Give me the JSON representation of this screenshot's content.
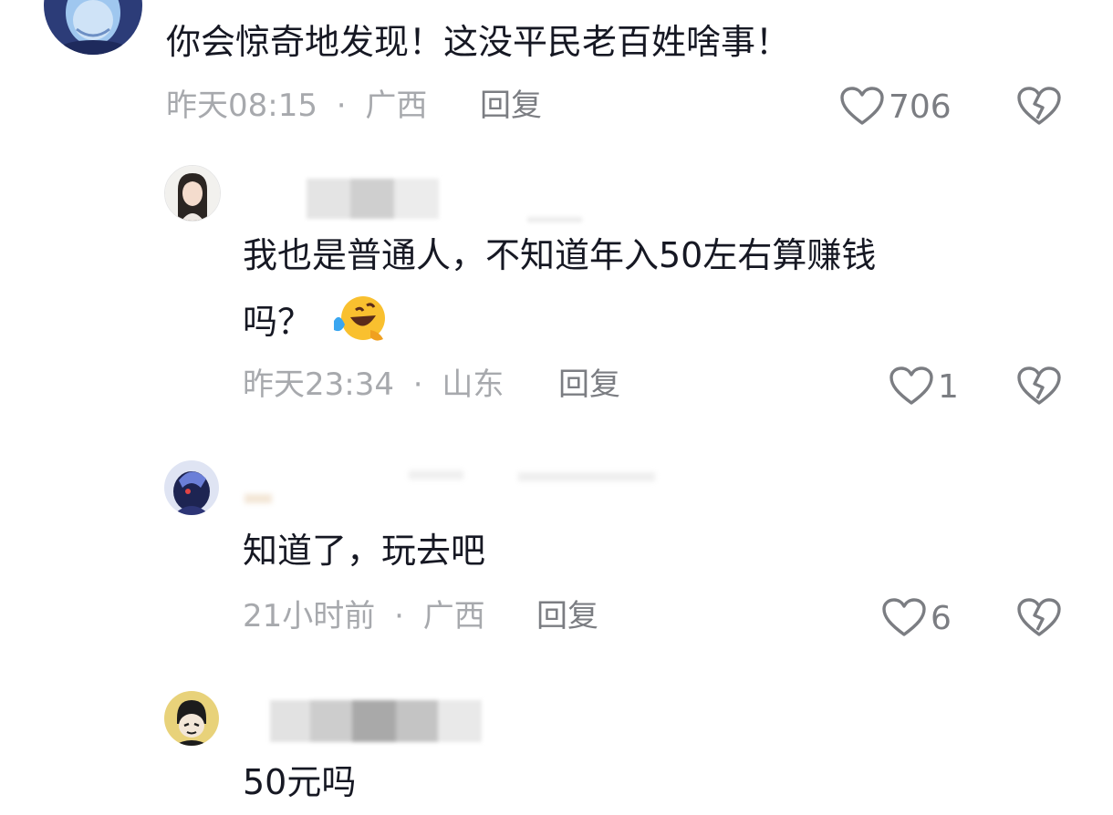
{
  "comments": [
    {
      "text": "你会惊奇地发现！这没平民老百姓啥事！",
      "time": "昨天08:15",
      "location": "广西",
      "reply_label": "回复",
      "likes": "706"
    },
    {
      "text_line1": "我也是普通人，不知道年入50左右算赚钱",
      "text_line2": "吗？",
      "emoji": "laughing-tears-emoji",
      "time": "昨天23:34",
      "location": "山东",
      "reply_label": "回复",
      "likes": "1"
    },
    {
      "text": "知道了，玩去吧",
      "time": "21小时前",
      "location": "广西",
      "reply_label": "回复",
      "likes": "6"
    },
    {
      "text": "50元吗"
    }
  ],
  "separator": "·",
  "icons": {
    "like": "heart-outline-icon",
    "dislike": "broken-heart-icon"
  },
  "colors": {
    "text": "#161823",
    "meta": "#a7a9ad",
    "icon": "#7b7d82"
  }
}
